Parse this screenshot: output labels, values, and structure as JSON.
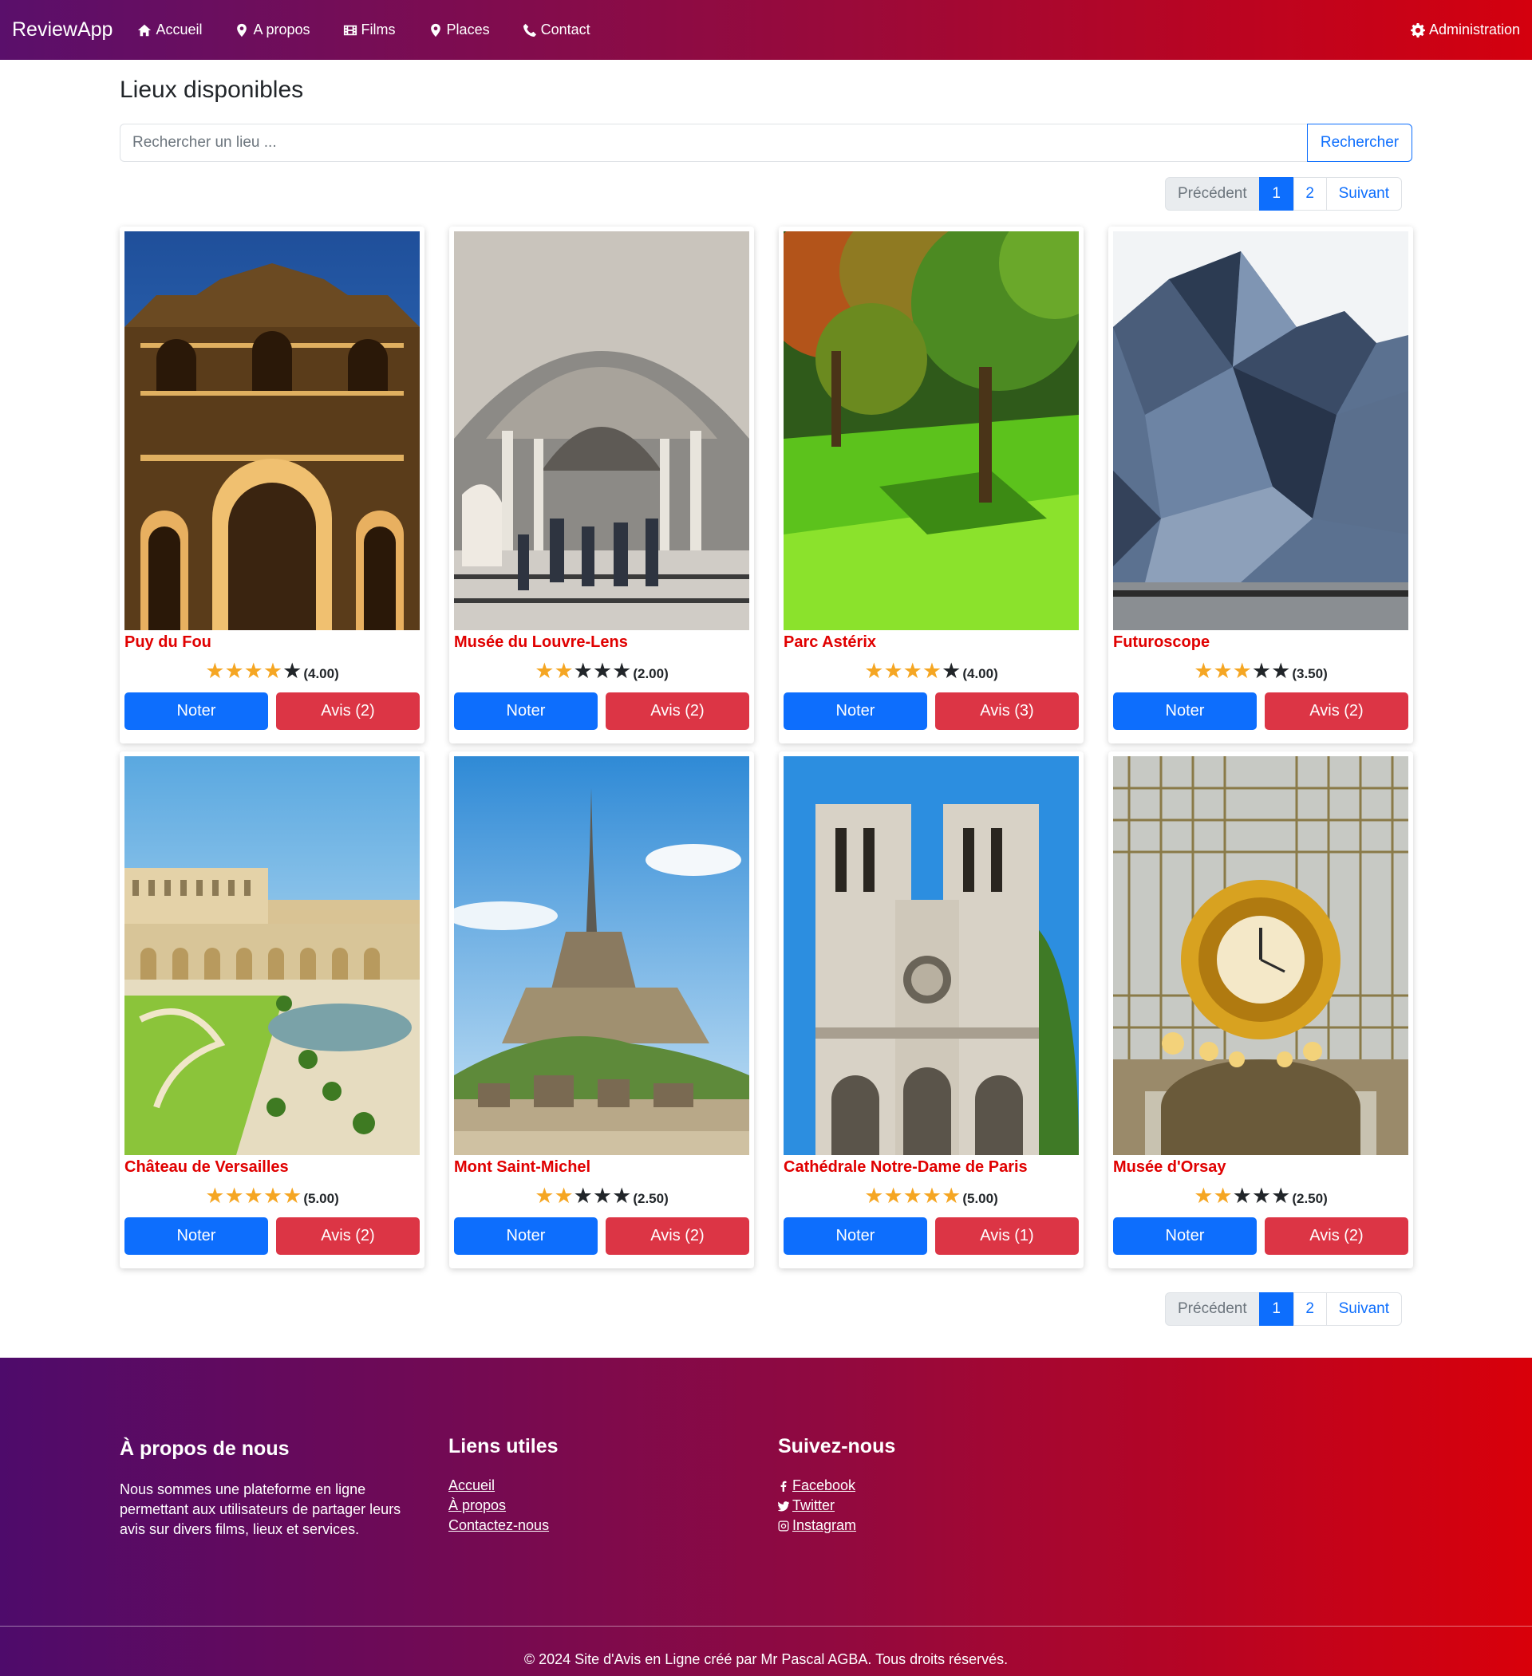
{
  "navbar": {
    "brand": "ReviewApp",
    "items": [
      {
        "label": "Accueil",
        "icon": "home-icon"
      },
      {
        "label": "A propos",
        "icon": "map-marker-icon"
      },
      {
        "label": "Films",
        "icon": "film-icon"
      },
      {
        "label": "Places",
        "icon": "map-marker-icon"
      },
      {
        "label": "Contact",
        "icon": "phone-icon"
      }
    ],
    "admin": {
      "label": "Administration",
      "icon": "gear-icon"
    }
  },
  "page": {
    "title": "Lieux disponibles",
    "search": {
      "placeholder": "Rechercher un lieu ...",
      "value": "",
      "button_label": "Rechercher"
    }
  },
  "pagination": {
    "prev_label": "Précédent",
    "pages": [
      "1",
      "2"
    ],
    "active_page": "1",
    "next_label": "Suivant"
  },
  "card_labels": {
    "noter": "Noter"
  },
  "places": [
    {
      "name": "Puy du Fou",
      "rating": 4.0,
      "rating_text": "(4.00)",
      "avis_label": "Avis (2)"
    },
    {
      "name": "Musée du Louvre-Lens",
      "rating": 2.0,
      "rating_text": "(2.00)",
      "avis_label": "Avis (2)"
    },
    {
      "name": "Parc Astérix",
      "rating": 4.0,
      "rating_text": "(4.00)",
      "avis_label": "Avis (3)"
    },
    {
      "name": "Futuroscope",
      "rating": 3.5,
      "rating_text": "(3.50)",
      "avis_label": "Avis (2)"
    },
    {
      "name": "Château de Versailles",
      "rating": 5.0,
      "rating_text": "(5.00)",
      "avis_label": "Avis (2)"
    },
    {
      "name": "Mont Saint-Michel",
      "rating": 2.5,
      "rating_text": "(2.50)",
      "avis_label": "Avis (2)"
    },
    {
      "name": "Cathédrale Notre-Dame de Paris",
      "rating": 5.0,
      "rating_text": "(5.00)",
      "avis_label": "Avis (1)"
    },
    {
      "name": "Musée d'Orsay",
      "rating": 2.5,
      "rating_text": "(2.50)",
      "avis_label": "Avis (2)"
    }
  ],
  "footer": {
    "about": {
      "title": "À propos de nous",
      "text": "Nous sommes une plateforme en ligne permettant aux utilisateurs de partager leurs avis sur divers films, lieux et services."
    },
    "links": {
      "title": "Liens utiles",
      "items": [
        "Accueil",
        "À propos",
        "Contactez-nous"
      ]
    },
    "social": {
      "title": "Suivez-nous",
      "items": [
        {
          "label": "Facebook",
          "icon": "facebook-icon"
        },
        {
          "label": "Twitter",
          "icon": "twitter-icon"
        },
        {
          "label": "Instagram",
          "icon": "instagram-icon"
        }
      ]
    },
    "copyright": "© 2024 Site d'Avis en Ligne créé par Mr Pascal AGBA. Tous droits réservés."
  },
  "colors": {
    "primary": "#0d6efd",
    "danger": "#dc3545",
    "title_red": "#e00000",
    "star": "#f5a623"
  }
}
